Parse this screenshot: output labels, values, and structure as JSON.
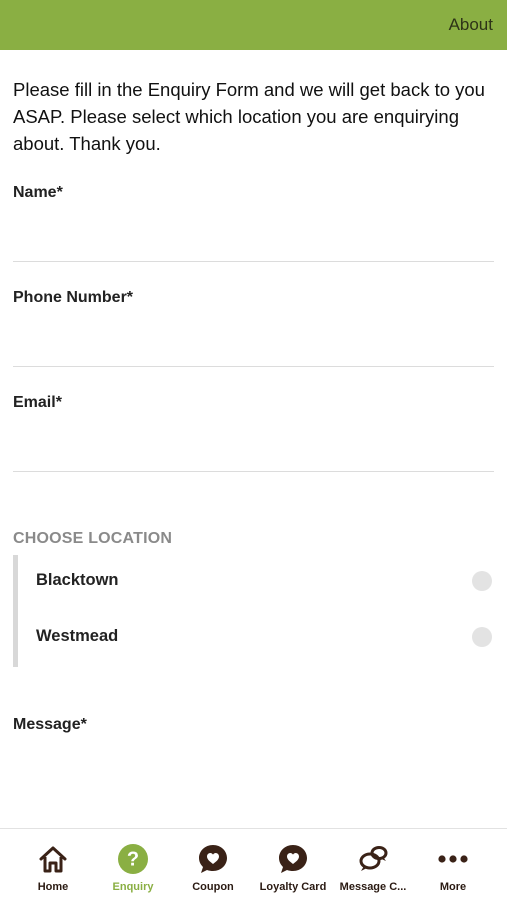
{
  "header": {
    "about_label": "About",
    "bar_color": "#8aaf43"
  },
  "intro": "Please fill in the Enquiry Form and we will get back to you ASAP. Please select which location you are enquirying about. Thank you.",
  "form": {
    "name_label": "Name*",
    "name_value": "",
    "phone_label": "Phone Number*",
    "phone_value": "",
    "email_label": "Email*",
    "email_value": "",
    "location_title": "CHOOSE LOCATION",
    "locations": [
      {
        "label": "Blacktown",
        "selected": false
      },
      {
        "label": "Westmead",
        "selected": false
      }
    ],
    "message_label": "Message*",
    "message_value": ""
  },
  "tabs": [
    {
      "label": "Home",
      "icon": "home-icon",
      "active": false
    },
    {
      "label": "Enquiry",
      "icon": "question-icon",
      "active": true
    },
    {
      "label": "Coupon",
      "icon": "heart-bubble-icon",
      "active": false
    },
    {
      "label": "Loyalty Card",
      "icon": "heart-bubble-icon",
      "active": false
    },
    {
      "label": "Message C...",
      "icon": "chat-bubbles-icon",
      "active": false
    },
    {
      "label": "More",
      "icon": "more-dots-icon",
      "active": false
    }
  ],
  "colors": {
    "accent": "#8aaf43",
    "icon_dark": "#3a2217"
  }
}
